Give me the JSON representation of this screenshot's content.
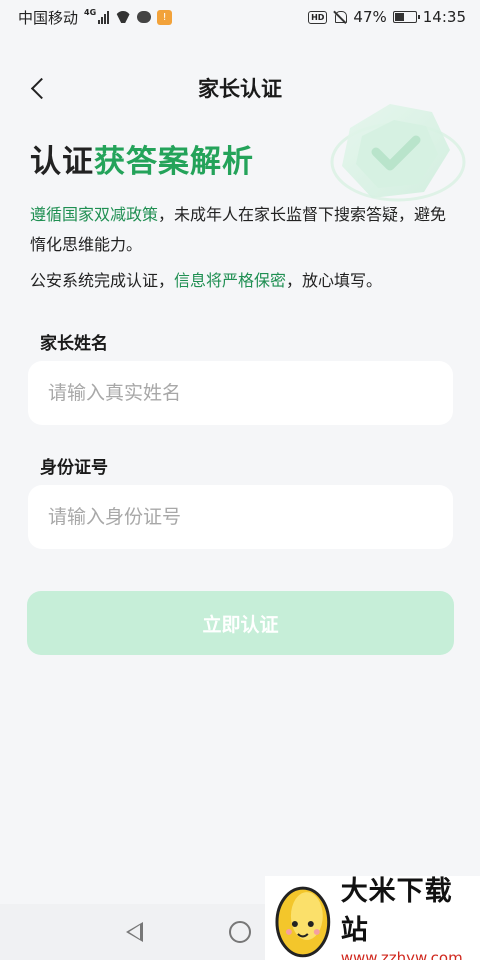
{
  "status_bar": {
    "carrier": "中国移动",
    "network": "4G",
    "battery": "47%",
    "battery_level": 0.47,
    "time": "14:35",
    "app_badge": "!",
    "hd": "HD"
  },
  "nav": {
    "title": "家长认证",
    "back_icon": "chevron-left-icon"
  },
  "headline": {
    "part1": "认证",
    "part2": "获答案解析"
  },
  "description": {
    "line1_highlight": "遵循国家双减政策",
    "line1_rest": "，未成年人在家长监督下搜索答疑，避免惰化思维能力。",
    "line2_start": "公安系统完成认证，",
    "line2_highlight": "信息将严格保密",
    "line2_end": "，放心填写。"
  },
  "form": {
    "name_label": "家长姓名",
    "name_placeholder": "请输入真实姓名",
    "id_label": "身份证号",
    "id_placeholder": "请输入身份证号",
    "submit_label": "立即认证"
  },
  "colors": {
    "accent": "#24a35a",
    "highlight_text": "#1f8f52",
    "button_disabled": "#c6eed8",
    "background": "#f5f6f8"
  },
  "watermark": {
    "name": "大米下载站",
    "url": "www.zzhyw.com"
  }
}
